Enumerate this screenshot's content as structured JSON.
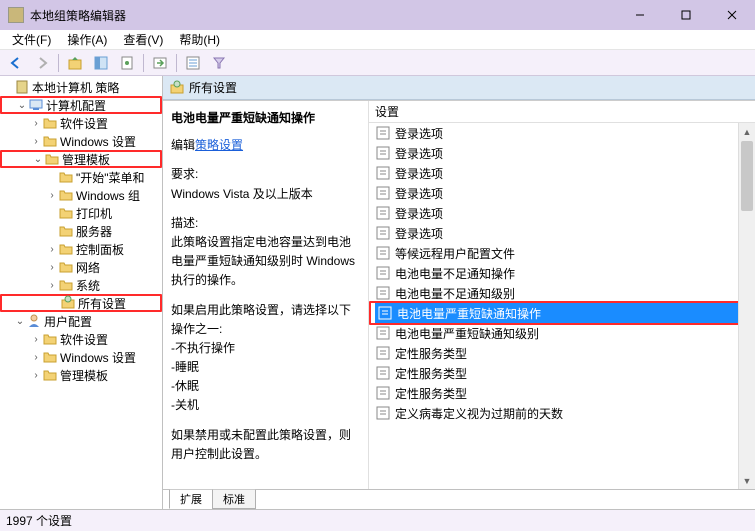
{
  "window": {
    "title": "本地组策略编辑器"
  },
  "menu": {
    "file": "文件(F)",
    "action": "操作(A)",
    "view": "查看(V)",
    "help": "帮助(H)"
  },
  "tree": {
    "root": "本地计算机 策略",
    "computer_config": "计算机配置",
    "software_settings": "软件设置",
    "windows_settings": "Windows 设置",
    "admin_templates": "管理模板",
    "start_menu": "\"开始\"菜单和",
    "windows_comp": "Windows 组",
    "printers": "打印机",
    "servers": "服务器",
    "control_panel": "控制面板",
    "network": "网络",
    "system": "系统",
    "all_settings": "所有设置",
    "user_config": "用户配置",
    "u_software_settings": "软件设置",
    "u_windows_settings": "Windows 设置",
    "u_admin_templates": "管理模板"
  },
  "right": {
    "header": "所有设置",
    "detail": {
      "title": "电池电量严重短缺通知操作",
      "edit_prefix": "编辑",
      "policy_link": "策略设置",
      "req_label": "要求:",
      "req_value": "Windows Vista 及以上版本",
      "desc_label": "描述:",
      "desc_body": "此策略设置指定电池容量达到电池电量严重短缺通知级别时 Windows 执行的操作。",
      "if_enabled": "如果启用此策略设置，请选择以下操作之一:",
      "opt1": "-不执行操作",
      "opt2": "-睡眠",
      "opt3": "-休眠",
      "opt4": "-关机",
      "if_disabled": "如果禁用或未配置此策略设置，则用户控制此设置。"
    },
    "list": {
      "header": "设置",
      "items": [
        "登录选项",
        "登录选项",
        "登录选项",
        "登录选项",
        "登录选项",
        "登录选项",
        "等候远程用户配置文件",
        "电池电量不足通知操作",
        "电池电量不足通知级别",
        "电池电量严重短缺通知操作",
        "电池电量严重短缺通知级别",
        "定性服务类型",
        "定性服务类型",
        "定性服务类型",
        "定义病毒定义视为过期前的天数"
      ],
      "selected_index": 9
    },
    "tabs": {
      "extended": "扩展",
      "standard": "标准"
    }
  },
  "status": {
    "count": "1997 个设置"
  }
}
